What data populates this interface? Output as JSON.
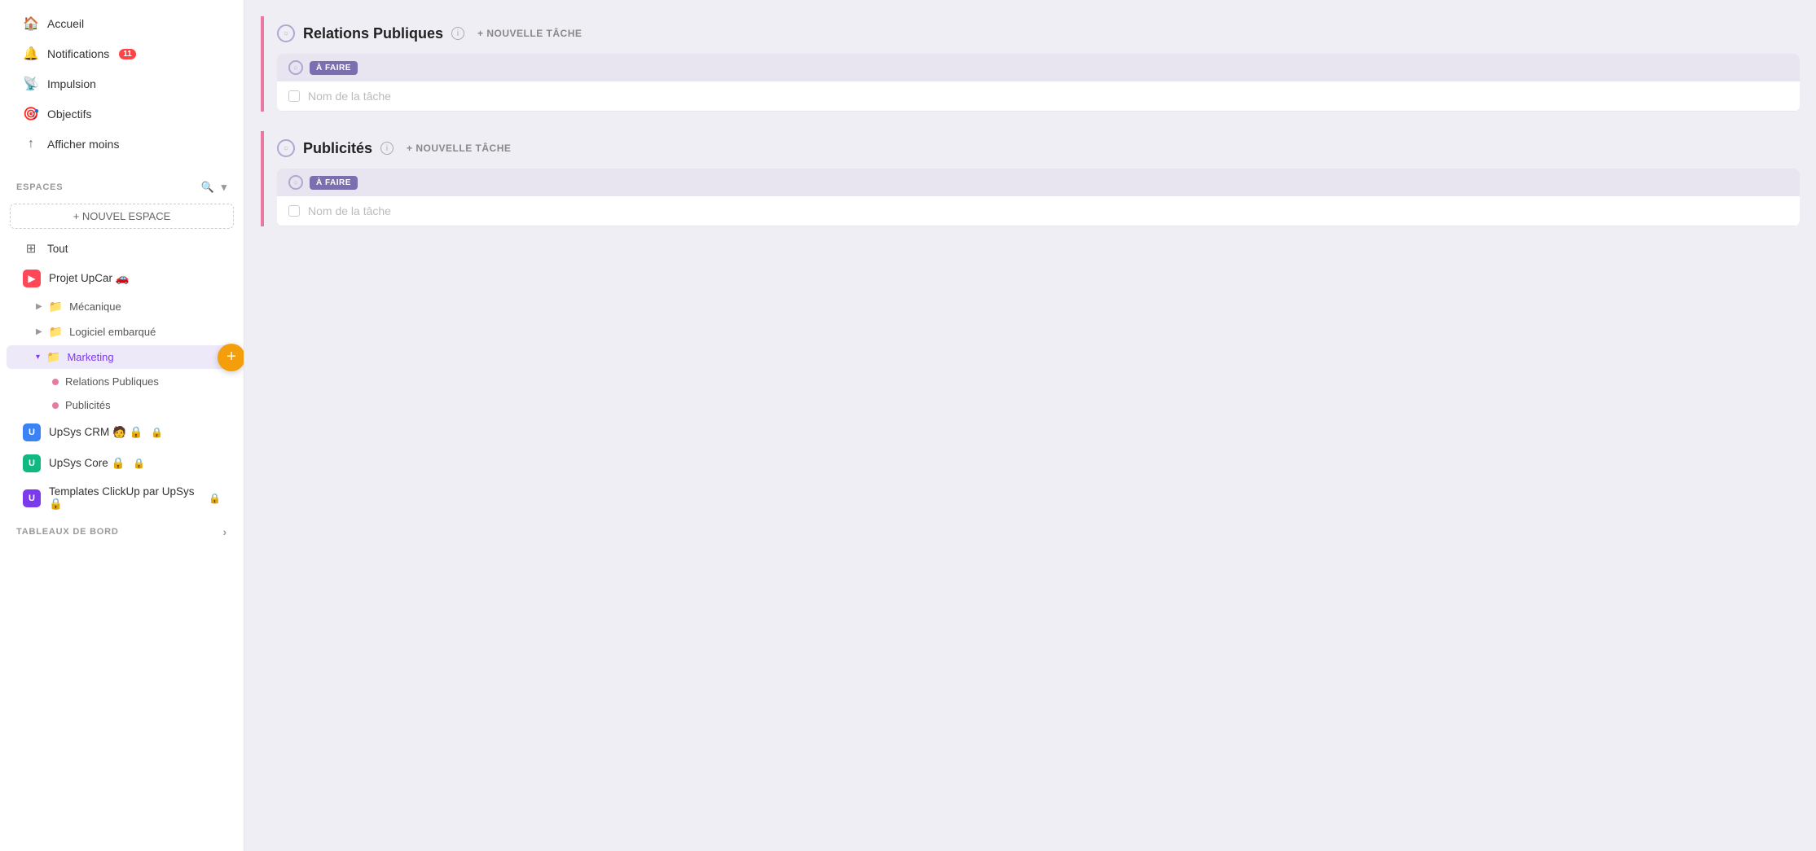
{
  "sidebar": {
    "nav": [
      {
        "id": "accueil",
        "label": "Accueil",
        "icon": "🏠"
      },
      {
        "id": "notifications",
        "label": "Notifications",
        "icon": "🔔",
        "badge": "11"
      },
      {
        "id": "impulsion",
        "label": "Impulsion",
        "icon": "📡"
      },
      {
        "id": "objectifs",
        "label": "Objectifs",
        "icon": "🎯"
      },
      {
        "id": "afficher-moins",
        "label": "Afficher moins",
        "icon": "↑"
      }
    ],
    "espaces_label": "ESPACES",
    "new_space_label": "+ NOUVEL ESPACE",
    "spaces": [
      {
        "id": "tout",
        "label": "Tout",
        "icon_type": "grid",
        "icon_color": ""
      },
      {
        "id": "projet-upcar",
        "label": "Projet UpCar 🚗",
        "icon_type": "red",
        "has_add": true
      },
      {
        "id": "mecanique",
        "label": "Mécanique",
        "type": "folder",
        "indent": 1
      },
      {
        "id": "logiciel-embarque",
        "label": "Logiciel embarqué",
        "type": "folder",
        "indent": 1
      },
      {
        "id": "marketing",
        "label": "Marketing",
        "type": "folder",
        "indent": 1,
        "active": true,
        "expanded": true
      },
      {
        "id": "relations-publiques",
        "label": "Relations Publiques",
        "type": "sub",
        "color": "#e879a0"
      },
      {
        "id": "publicites",
        "label": "Publicités",
        "type": "sub",
        "color": "#e879a0"
      },
      {
        "id": "upsys-crm",
        "label": "UpSys CRM 🧑 🔒",
        "icon_type": "blue"
      },
      {
        "id": "upsys-core",
        "label": "UpSys Core 🔒",
        "icon_type": "green"
      },
      {
        "id": "templates",
        "label": "Templates ClickUp par UpSys 🔒",
        "icon_type": "purple"
      }
    ],
    "tableaux_label": "TABLEAUX DE BORD"
  },
  "main": {
    "sections": [
      {
        "id": "relations-publiques",
        "title": "Relations Publiques",
        "new_task_label": "+ NOUVELLE TÂCHE",
        "status_groups": [
          {
            "status": "À FAIRE",
            "tasks": [
              {
                "id": "task-1",
                "name": "",
                "placeholder": "Nom de la tâche"
              }
            ]
          }
        ]
      },
      {
        "id": "publicites",
        "title": "Publicités",
        "new_task_label": "+ NOUVELLE TÂCHE",
        "status_groups": [
          {
            "status": "À FAIRE",
            "tasks": [
              {
                "id": "task-2",
                "name": "",
                "placeholder": "Nom de la tâche"
              }
            ]
          }
        ]
      }
    ]
  }
}
